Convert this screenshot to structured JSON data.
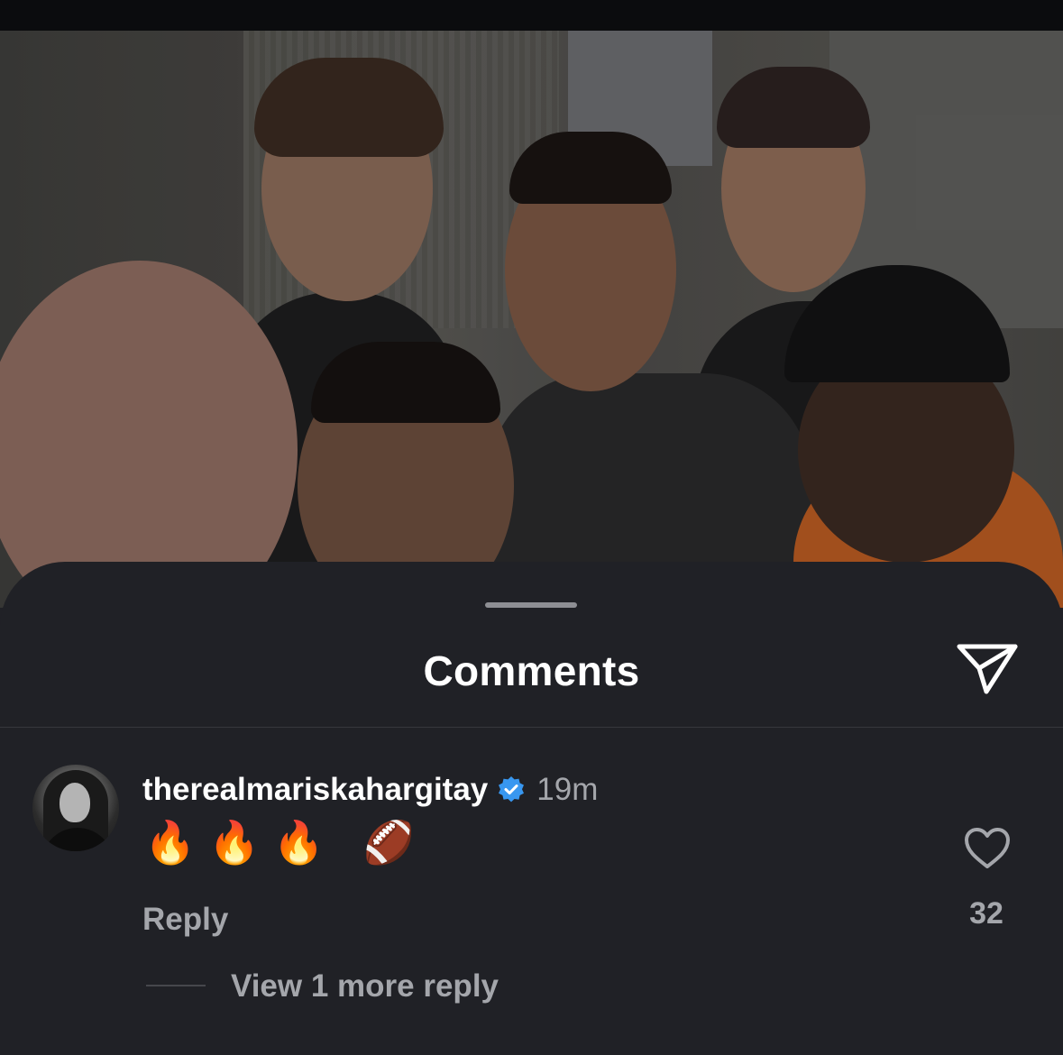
{
  "sheet": {
    "title": "Comments",
    "share_icon": "send-icon"
  },
  "comment": {
    "username": "therealmariskahargitay",
    "verified_icon": "verified-badge-icon",
    "time": "19m",
    "text": "🔥🔥🔥 🏈",
    "reply_label": "Reply",
    "like_icon": "heart-icon",
    "like_count": "32"
  },
  "replies": {
    "view_more_label": "View 1 more reply"
  },
  "colors": {
    "sheet_background": "#202126",
    "primary_text": "#ffffff",
    "secondary_text": "#a4a6ab",
    "verified_blue": "#3897f0"
  }
}
